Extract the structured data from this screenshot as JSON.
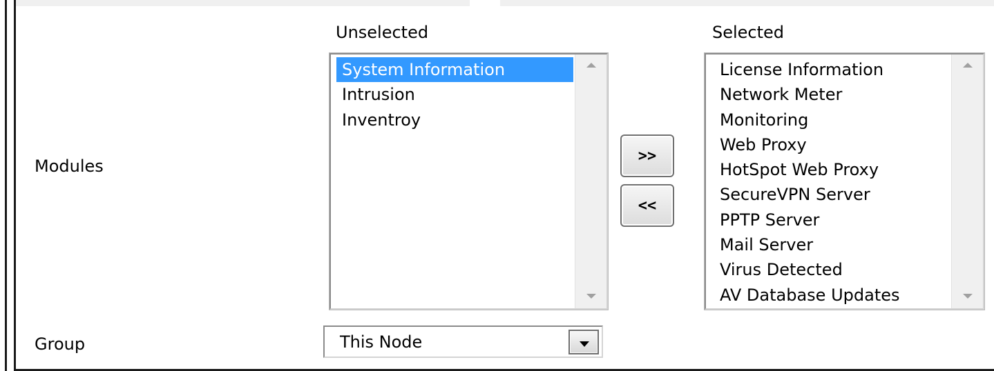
{
  "form": {
    "modules_label": "Modules",
    "group_label": "Group",
    "unselected": {
      "header": "Unselected",
      "items": [
        "System Information",
        "Intrusion",
        "Inventroy"
      ],
      "selected_index": 0
    },
    "selected": {
      "header": "Selected",
      "items": [
        "License Information",
        "Network Meter",
        "Monitoring",
        "Web Proxy",
        "HotSpot Web Proxy",
        "SecureVPN Server",
        "PPTP Server",
        "Mail Server",
        "Virus Detected",
        "AV Database Updates"
      ]
    },
    "buttons": {
      "add_label": ">>",
      "remove_label": "<<"
    },
    "group_select": {
      "value": "This Node"
    }
  },
  "icons": {
    "scroll_up": "chevron-up-icon",
    "scroll_down": "chevron-down-icon",
    "dropdown": "triangle-down-icon"
  },
  "colors": {
    "selection": "#3399ff",
    "selection_text": "#ffffff",
    "frame": "#1a1a1a",
    "scrollbar": "#f0f0f0"
  }
}
